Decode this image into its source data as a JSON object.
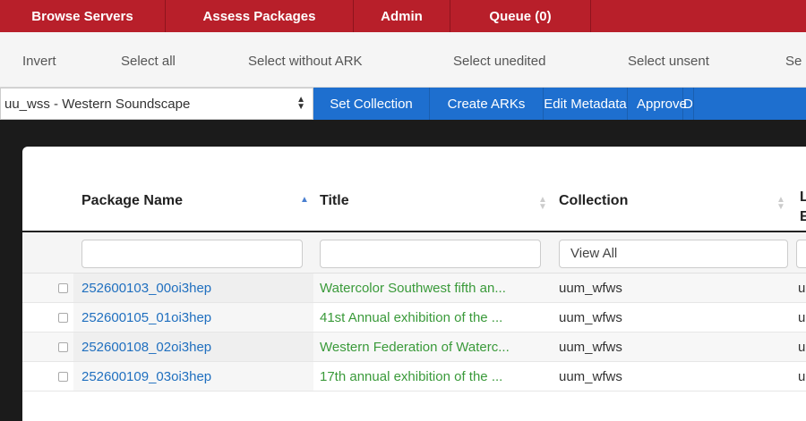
{
  "top_nav": {
    "items": [
      "Browse Servers",
      "Assess Packages",
      "Admin",
      "Queue (0)"
    ],
    "color": "#b81f2a"
  },
  "select_bar": {
    "items": [
      "Invert",
      "Select all",
      "Select without ARK",
      "Select unedited",
      "Select unsent",
      "Se"
    ]
  },
  "action_bar": {
    "collection_value": "uu_wss - Western Soundscape",
    "buttons": [
      "Set Collection",
      "Create ARKs",
      "Edit Metadata",
      "Approve",
      "D"
    ],
    "color": "#1e6fcf"
  },
  "table": {
    "headers": {
      "package_name": "Package Name",
      "title": "Title",
      "collection": "Collection",
      "last_line1": "L",
      "last_line2": "E"
    },
    "filters": {
      "package_name": "",
      "title": "",
      "collection": "View All"
    },
    "rows": [
      {
        "package": "252600103_00oi3hep",
        "title": "Watercolor Southwest fifth an...",
        "collection": "uum_wfws",
        "last": "u"
      },
      {
        "package": "252600105_01oi3hep",
        "title": "41st Annual exhibition of the ...",
        "collection": "uum_wfws",
        "last": "u"
      },
      {
        "package": "252600108_02oi3hep",
        "title": "Western Federation of Waterc...",
        "collection": "uum_wfws",
        "last": "u"
      },
      {
        "package": "252600109_03oi3hep",
        "title": "17th annual exhibition of the ...",
        "collection": "uum_wfws",
        "last": "u"
      }
    ]
  },
  "icons": {
    "sort_asc": "sort-ascending-icon",
    "sort_both": "sort-both-icon",
    "select_arrows": "select-arrows-icon"
  }
}
